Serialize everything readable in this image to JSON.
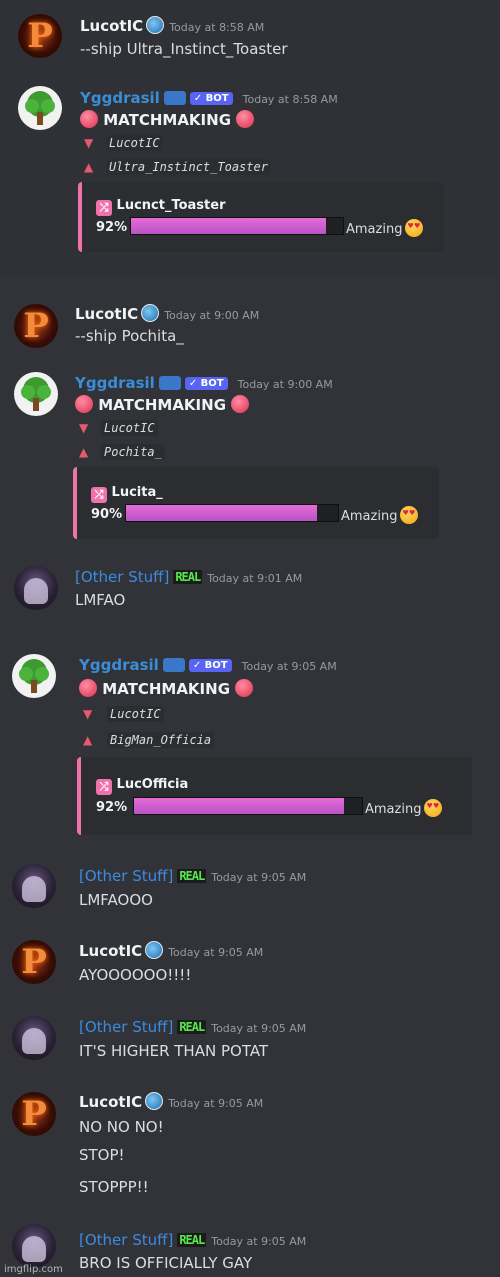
{
  "screenshots": [
    {
      "messages": [
        {
          "author": "LucotIC",
          "timestamp": "Today at 8:58 AM",
          "lines": [
            "--ship Ultra_Instinct_Toaster"
          ]
        },
        {
          "author": "Yggdrasil",
          "badge": "✓ BOT",
          "timestamp": "Today at 8:58 AM",
          "heading": "MATCHMAKING",
          "user1": "LucotIC",
          "user2": "Ultra_Instinct_Toaster",
          "embed": {
            "title": "Lucnct_Toaster",
            "percent_label": "92%",
            "percent": 0.92,
            "verdict": "Amazing"
          }
        }
      ]
    },
    {
      "messages": [
        {
          "author": "LucotIC",
          "timestamp": "Today at 9:00 AM",
          "lines": [
            "--ship Pochita_"
          ]
        },
        {
          "author": "Yggdrasil",
          "badge": "✓ BOT",
          "timestamp": "Today at 9:00 AM",
          "heading": "MATCHMAKING",
          "user1": "LucotIC",
          "user2": "Pochita_",
          "embed": {
            "title": "Lucita_",
            "percent_label": "90%",
            "percent": 0.9,
            "verdict": "Amazing"
          }
        },
        {
          "author": "[Other Stuff]",
          "tag": "REAL",
          "timestamp": "Today at 9:01 AM",
          "lines": [
            "LMFAO"
          ]
        }
      ]
    },
    {
      "messages": [
        {
          "author": "Yggdrasil",
          "badge": "✓ BOT",
          "timestamp": "Today at 9:05 AM",
          "heading": "MATCHMAKING",
          "user1": "LucotIC",
          "user2": "BigMan_Officia",
          "embed": {
            "title": "LucOfficia",
            "percent_label": "92%",
            "percent": 0.92,
            "verdict": "Amazing"
          }
        },
        {
          "author": "[Other Stuff]",
          "tag": "REAL",
          "timestamp": "Today at 9:05 AM",
          "lines": [
            "LMFAOOO"
          ]
        },
        {
          "author": "LucotIC",
          "timestamp": "Today at 9:05 AM",
          "lines": [
            "AYOOOOOO!!!!"
          ]
        },
        {
          "author": "[Other Stuff]",
          "tag": "REAL",
          "timestamp": "Today at 9:05 AM",
          "lines": [
            "IT'S HIGHER THAN POTAT"
          ]
        },
        {
          "author": "LucotIC",
          "timestamp": "Today at 9:05 AM",
          "lines": [
            "NO NO NO!",
            "STOP!",
            "STOPPP!!"
          ]
        },
        {
          "author": "[Other Stuff]",
          "tag": "REAL",
          "timestamp": "Today at 9:05 AM",
          "lines": [
            "BRO IS OFFICIALLY GAY"
          ]
        }
      ]
    }
  ],
  "avatar_letter": "P",
  "watermark": "imgflip.com",
  "colors": {
    "background": "#313338",
    "accent_pink": "#ef72ad",
    "bot_badge": "#5865f2",
    "real_green": "#55e84a",
    "bot_name": "#3a8dd6"
  }
}
